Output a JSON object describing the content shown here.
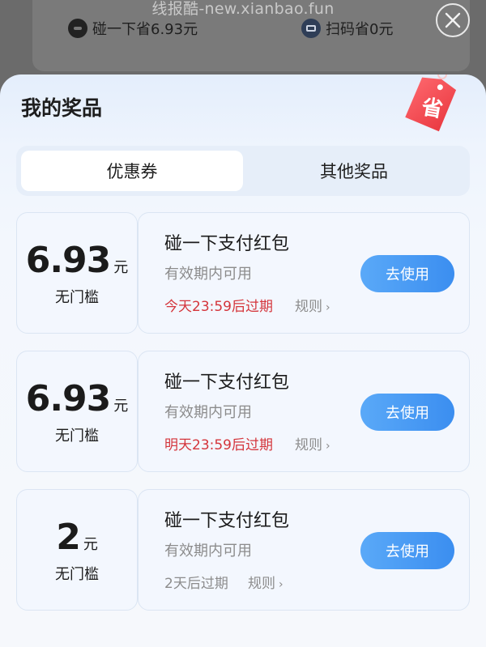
{
  "watermark": "线报酷-new.xianbao.fun",
  "background": {
    "left_item": "碰一下省6.93元",
    "right_item": "扫码省0元"
  },
  "sheet": {
    "title": "我的奖品",
    "badge_char": "省"
  },
  "tabs": [
    {
      "label": "优惠券",
      "active": true
    },
    {
      "label": "其他奖品",
      "active": false
    }
  ],
  "coupons": [
    {
      "amount": "6.93",
      "unit": "元",
      "threshold": "无门槛",
      "name": "碰一下支付红包",
      "desc": "有效期内可用",
      "expiry": "今天23:59后过期",
      "rules": "规则",
      "button": "去使用"
    },
    {
      "amount": "6.93",
      "unit": "元",
      "threshold": "无门槛",
      "name": "碰一下支付红包",
      "desc": "有效期内可用",
      "expiry": "明天23:59后过期",
      "rules": "规则",
      "button": "去使用"
    },
    {
      "amount": "2",
      "unit": "元",
      "threshold": "无门槛",
      "name": "碰一下支付红包",
      "desc": "有效期内可用",
      "expiry": "2天后过期",
      "rules": "规则",
      "button": "去使用"
    }
  ],
  "colors": {
    "accent_blue": "#3b8ef0",
    "expiry_red": "#d4353b",
    "badge_red": "#f04a52"
  }
}
